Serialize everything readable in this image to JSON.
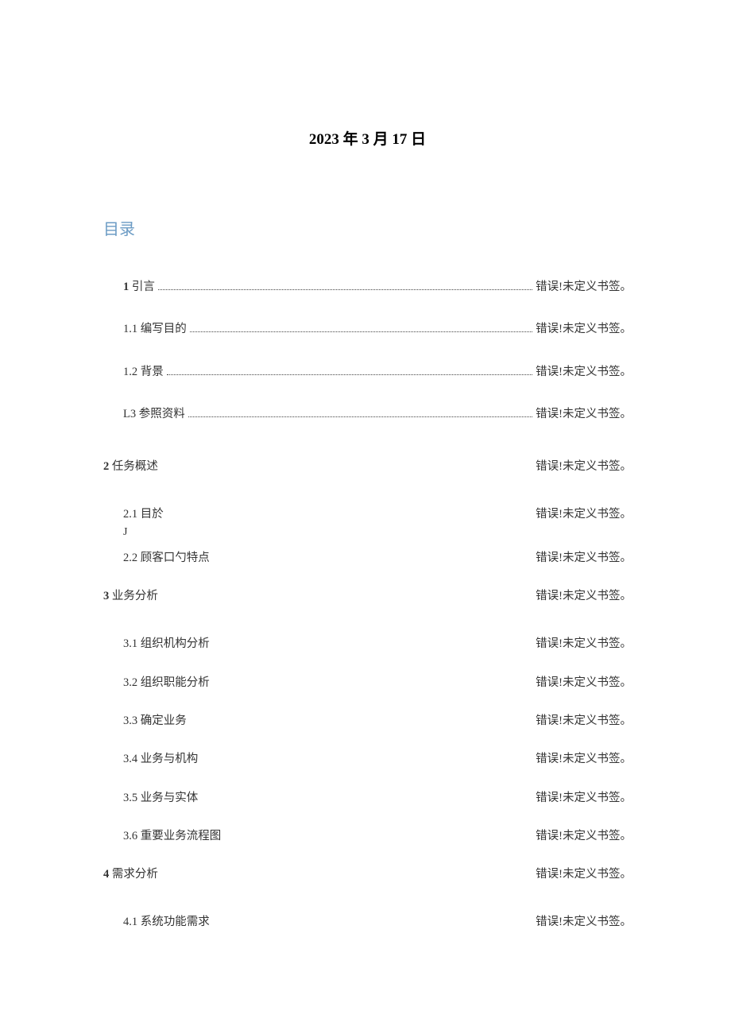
{
  "date_title": "2023 年 3 月 17 日",
  "toc_title": "目录",
  "error_text": "错误!未定义书签。",
  "toc": [
    {
      "level": 1,
      "num": "1",
      "label": "引言",
      "dotted": true,
      "style": "section"
    },
    {
      "level": 1,
      "num": "1.1",
      "label": "编写目的",
      "dotted": true,
      "style": "sub"
    },
    {
      "level": 1,
      "num": "1.2",
      "label": "背景",
      "dotted": true,
      "style": "sub"
    },
    {
      "level": 1,
      "num": "L3",
      "label": "参照资料",
      "dotted": true,
      "style": "sub",
      "spaced_err": true
    },
    {
      "level": 0,
      "num": "2",
      "label": "任务概述",
      "dotted": false,
      "style": "section"
    },
    {
      "level": 1,
      "num": "2.1",
      "label": "目於",
      "dotted": false,
      "style": "sub",
      "j_below": "J"
    },
    {
      "level": 1,
      "num": "2.2",
      "label": "顾客口勺特点",
      "dotted": false,
      "style": "sub"
    },
    {
      "level": 0,
      "num": "3",
      "label": "业务分析",
      "dotted": false,
      "style": "section"
    },
    {
      "level": 1,
      "num": "3.1",
      "label": "组织机构分析",
      "dotted": false,
      "style": "sub"
    },
    {
      "level": 1,
      "num": "3.2",
      "label": "组织职能分析",
      "dotted": false,
      "style": "sub"
    },
    {
      "level": 1,
      "num": "3.3",
      "label": "确定业务",
      "dotted": false,
      "style": "sub"
    },
    {
      "level": 1,
      "num": "3.4",
      "label": "业务与机构",
      "dotted": false,
      "style": "sub"
    },
    {
      "level": 1,
      "num": "3.5",
      "label": "业务与实体",
      "dotted": false,
      "style": "sub"
    },
    {
      "level": 1,
      "num": "3.6",
      "label": "重要业务流程图",
      "dotted": false,
      "style": "sub"
    },
    {
      "level": 0,
      "num": "4",
      "label": "需求分析",
      "dotted": false,
      "style": "section"
    },
    {
      "level": 1,
      "num": "4.1",
      "label": "系统功能需求",
      "dotted": false,
      "style": "sub"
    }
  ]
}
